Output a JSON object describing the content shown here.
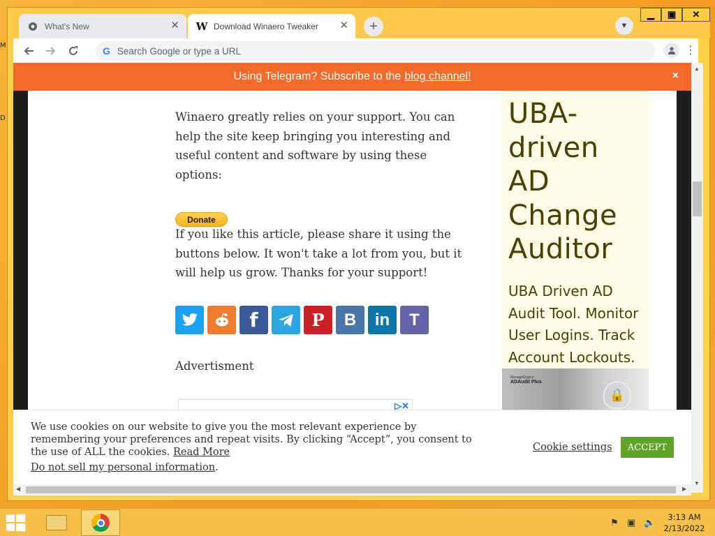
{
  "desktop": {
    "edge_labels": [
      "M",
      "D"
    ]
  },
  "browser": {
    "tabs": [
      {
        "title": "What's New",
        "icon": "gear-icon",
        "active": false
      },
      {
        "title": "Download Winaero Tweaker",
        "icon": "winaero-w-icon",
        "active": true
      }
    ],
    "omnibox_placeholder": "Search Google or type a URL"
  },
  "banner": {
    "text": "Using Telegram? Subscribe to the",
    "link": "blog channel!",
    "close": "×"
  },
  "article": {
    "para1": "Winaero greatly relies on your support. You can help the site keep bringing you interesting and useful content and software by using these options:",
    "donate_label": "Donate",
    "para2": "If you like this article, please share it using the buttons below. It won't take a lot from you, but it will help us grow. Thanks for your support!",
    "share_buttons": [
      {
        "name": "Twitter",
        "color": "#1da1f2",
        "glyph": "🐦"
      },
      {
        "name": "Reddit",
        "color": "#ef7d2d",
        "glyph": "●"
      },
      {
        "name": "Facebook",
        "color": "#3b5998",
        "glyph": "f"
      },
      {
        "name": "Telegram",
        "color": "#2ca5e0",
        "glyph": "➤"
      },
      {
        "name": "Pinterest",
        "color": "#cb2027",
        "glyph": "P"
      },
      {
        "name": "VK",
        "color": "#4a76a8",
        "glyph": "B"
      },
      {
        "name": "LinkedIn",
        "color": "#0e76a8",
        "glyph": "in"
      },
      {
        "name": "Teams",
        "color": "#6264a7",
        "glyph": "T"
      }
    ],
    "ad_label": "Advertisment"
  },
  "side_ad": {
    "headline": "UBA-driven AD Change Auditor",
    "body": "UBA Driven AD Audit Tool. Monitor User Logins. Track Account Lockouts.",
    "image_brand": "ManageEngine",
    "image_product": "ADAudit Plus"
  },
  "cookie_notice": {
    "text": "We use cookies on our website to give you the most relevant experience by remembering your preferences and repeat visits. By clicking “Accept”, you consent to the use of ALL the cookies.",
    "read_more": "Read More",
    "do_not_sell": "Do not sell my personal information",
    "do_not_sell_suffix": ".",
    "settings_label": "Cookie settings",
    "accept_label": "ACCEPT"
  },
  "taskbar": {
    "time": "3:13 AM",
    "date": "2/13/2022"
  }
}
